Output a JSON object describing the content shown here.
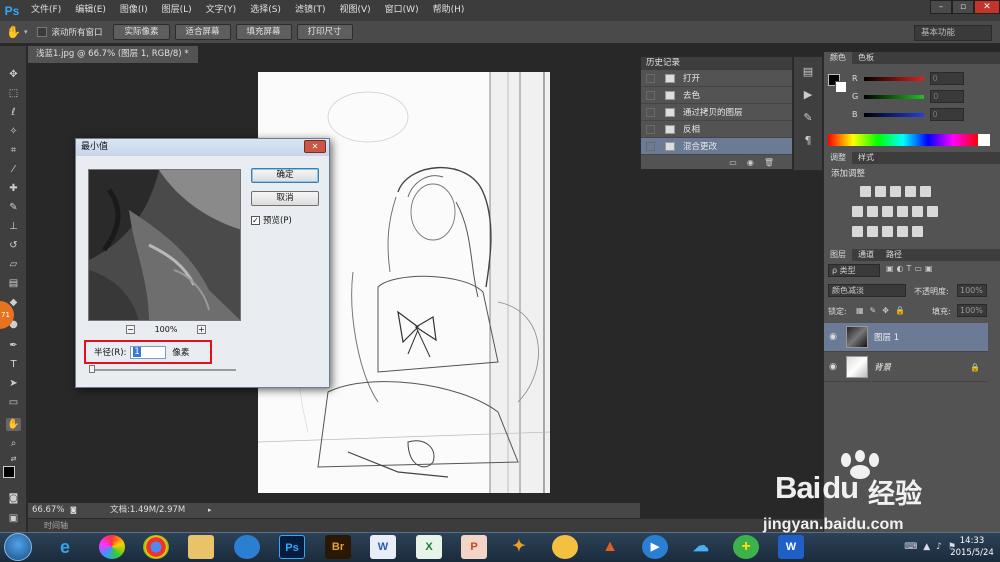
{
  "app": {
    "logo": "Ps"
  },
  "menu": [
    "文件(F)",
    "编辑(E)",
    "图像(I)",
    "图层(L)",
    "文字(Y)",
    "选择(S)",
    "滤镜(T)",
    "视图(V)",
    "窗口(W)",
    "帮助(H)"
  ],
  "window_controls": {
    "minimize": "–",
    "restore": "▫",
    "close": "✕"
  },
  "options": {
    "scroll_all": "滚动所有窗口",
    "buttons": [
      "实际像素",
      "适合屏幕",
      "填充屏幕",
      "打印尺寸"
    ],
    "workspace": "基本功能"
  },
  "document": {
    "tab": "浅蓝1.jpg @ 66.7% (图层 1, RGB/8) *",
    "zoom": "66.67%",
    "doc_size": "文档:1.49M/2.97M"
  },
  "timeline": "时间轴",
  "history": {
    "title": "历史记录",
    "items": [
      "打开",
      "去色",
      "通过拷贝的图层",
      "反相",
      "混合更改"
    ],
    "selected_index": 4
  },
  "color_panel": {
    "tabs": [
      "颜色",
      "色板"
    ],
    "channels": [
      {
        "label": "R",
        "value": "0",
        "color": "#e02020"
      },
      {
        "label": "G",
        "value": "0",
        "color": "#20c020"
      },
      {
        "label": "B",
        "value": "0",
        "color": "#2040e0"
      }
    ]
  },
  "adjust_panel": {
    "tabs": [
      "调整",
      "样式"
    ],
    "hint": "添加调整"
  },
  "layers_panel": {
    "tabs": [
      "图层",
      "通道",
      "路径"
    ],
    "filter_kind": "ρ 类型",
    "blend_mode": "颜色减淡",
    "opacity_label": "不透明度:",
    "opacity_value": "100%",
    "lock_label": "锁定:",
    "fill_label": "填充:",
    "fill_value": "100%",
    "layers": [
      {
        "name": "图层 1",
        "selected": true,
        "locked": false
      },
      {
        "name": "背景",
        "selected": false,
        "locked": true
      }
    ]
  },
  "dialog": {
    "title": "最小值",
    "ok": "确定",
    "cancel": "取消",
    "preview_label": "预览(P)",
    "preview_checked": true,
    "zoom": "100%",
    "radius_label": "半径(R):",
    "radius_value": "1",
    "radius_unit": "像素"
  },
  "toolbar_badge": "71",
  "taskbar": {
    "apps": [
      "start",
      "ie",
      "pinwheel",
      "chrome",
      "explorer",
      "qq-player",
      "photoshop",
      "bridge",
      "word",
      "excel",
      "powerpoint",
      "tool",
      "paint",
      "matlab",
      "media-player",
      "cloud",
      "360",
      "wps"
    ],
    "time": "14:33",
    "date": "2015/5/24"
  },
  "watermark": {
    "brand": "Bai",
    "brand2": "du",
    "suffix": "经验",
    "url": "jingyan.baidu.com"
  }
}
